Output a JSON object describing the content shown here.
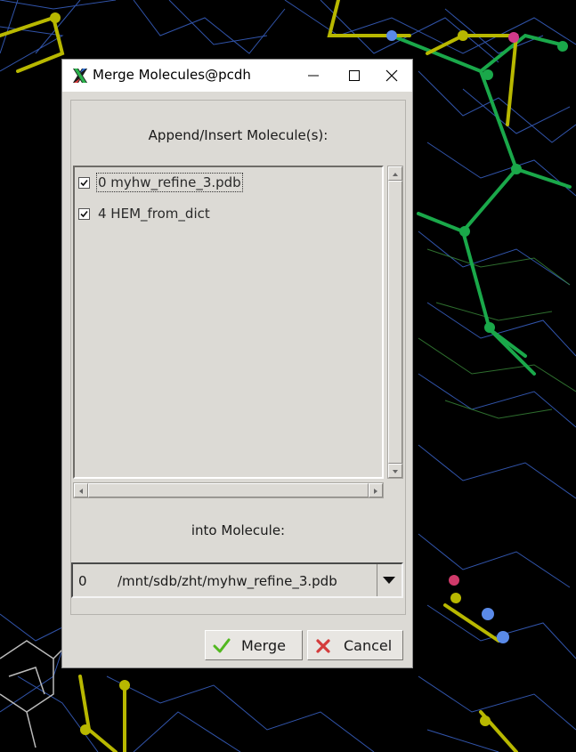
{
  "window": {
    "title": "Merge Molecules@pcdh",
    "controls": [
      "minimize-icon",
      "maximize-icon",
      "close-icon"
    ]
  },
  "dialog": {
    "append_heading": "Append/Insert Molecule(s):",
    "molecules": [
      {
        "label": "0 myhw_refine_3.pdb",
        "checked": true
      },
      {
        "label": "4 HEM_from_dict",
        "checked": true
      }
    ],
    "into_heading": "into Molecule:",
    "target": {
      "index": "0",
      "path": "/mnt/sdb/zht/myhw_refine_3.pdb"
    },
    "buttons": {
      "merge": {
        "label": "Merge",
        "icon": "green-check-icon"
      },
      "cancel": {
        "label": "Cancel",
        "icon": "red-x-icon"
      }
    }
  },
  "colors": {
    "dialog_bg": "#dcdad5",
    "titlebar_bg": "#ffffff",
    "merge_icon": "#52b820",
    "cancel_icon": "#d43c3c"
  }
}
